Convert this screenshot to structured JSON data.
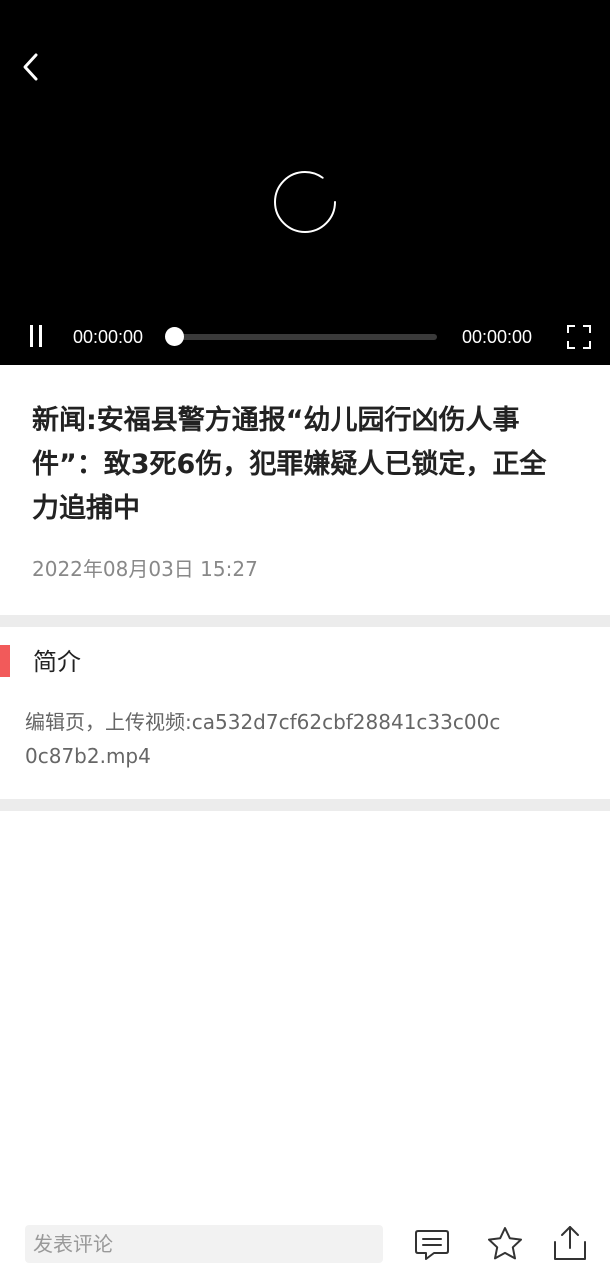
{
  "player": {
    "back_icon": "chevron-left-icon",
    "loading_icon": "loading-spinner-icon",
    "current_time": "00:00:00",
    "total_time": "00:00:00",
    "progress": 0,
    "pause_icon": "pause-icon",
    "fullscreen_icon": "fullscreen-icon"
  },
  "article": {
    "title": "新闻:安福县警方通报“幼儿园行凶伤人事件”：致3死6伤，犯罪嫌疑人已锁定，正全力追捕中",
    "date": "2022年08月03日 15:27"
  },
  "intro": {
    "heading": "简介",
    "accent_color": "#f25a5a",
    "body": "编辑页，上传视频:ca532d7cf62cbf28841c33c00c0c87b2.mp4"
  },
  "bottom_bar": {
    "comment_placeholder": "发表评论",
    "comment_icon": "comment-icon",
    "favorite_icon": "star-icon",
    "share_icon": "share-icon"
  }
}
